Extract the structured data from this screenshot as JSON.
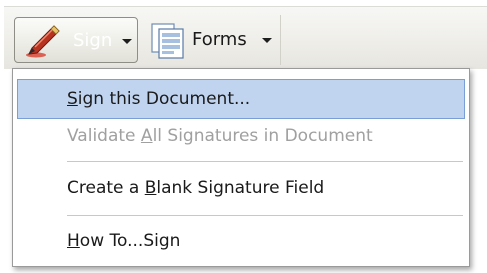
{
  "toolbar": {
    "sign_label": "Sign",
    "forms_label": "Forms",
    "sign_icon": "pen-icon",
    "forms_icon": "forms-document-icon",
    "dropdown_icon": "chevron-down-icon"
  },
  "menu": {
    "items": [
      {
        "pre": "",
        "mnemonic": "S",
        "post": "ign this Document...",
        "state": "highlighted"
      },
      {
        "pre": "Validate ",
        "mnemonic": "A",
        "post": "ll Signatures in Document",
        "state": "disabled"
      },
      {
        "pre": "Create a ",
        "mnemonic": "B",
        "post": "lank Signature Field",
        "state": "enabled"
      },
      {
        "pre": "",
        "mnemonic": "H",
        "post": "ow To...Sign",
        "state": "enabled"
      }
    ]
  },
  "colors": {
    "highlight": "#c0d4f0",
    "highlight_border": "#7a9ed6",
    "disabled_text": "#a0a0a0"
  }
}
